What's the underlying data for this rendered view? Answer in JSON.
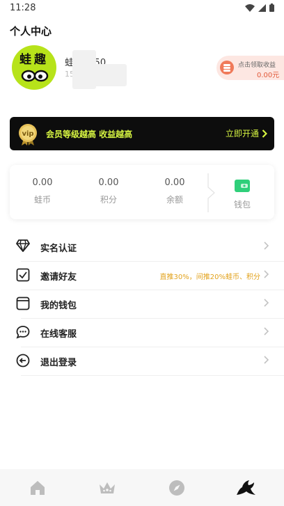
{
  "status_bar": {
    "time": "11:28"
  },
  "page": {
    "title": "个人中心"
  },
  "profile": {
    "name": "蛙趣0050",
    "phone": "150****",
    "avatar_text": "蛙趣"
  },
  "reward": {
    "title": "点击领取收益",
    "value": "0.00元"
  },
  "vip_banner": {
    "text": "会员等级越高 收益越高",
    "action": "立即开通",
    "badge": "vip"
  },
  "stats": [
    {
      "value": "0.00",
      "label": "蛙币"
    },
    {
      "value": "0.00",
      "label": "积分"
    },
    {
      "value": "0.00",
      "label": "余额"
    }
  ],
  "wallet": {
    "label": "钱包"
  },
  "menu": [
    {
      "label": "实名认证",
      "icon": "diamond-icon"
    },
    {
      "label": "邀请好友",
      "icon": "checked-box-icon",
      "sub": "直推30%，间推20%蛙币、积分"
    },
    {
      "label": "我的钱包",
      "icon": "wallet-icon"
    },
    {
      "label": "在线客服",
      "icon": "chat-icon"
    },
    {
      "label": "退出登录",
      "icon": "logout-icon"
    }
  ],
  "tabbar": [
    {
      "name": "home-icon"
    },
    {
      "name": "crown-icon"
    },
    {
      "name": "compass-icon"
    },
    {
      "name": "frog-icon"
    }
  ],
  "colors": {
    "accent": "#d7f542",
    "banner_bg": "#0d0d0d",
    "avatar_bg": "#b7e31a",
    "highlight": "#e2a21c"
  }
}
